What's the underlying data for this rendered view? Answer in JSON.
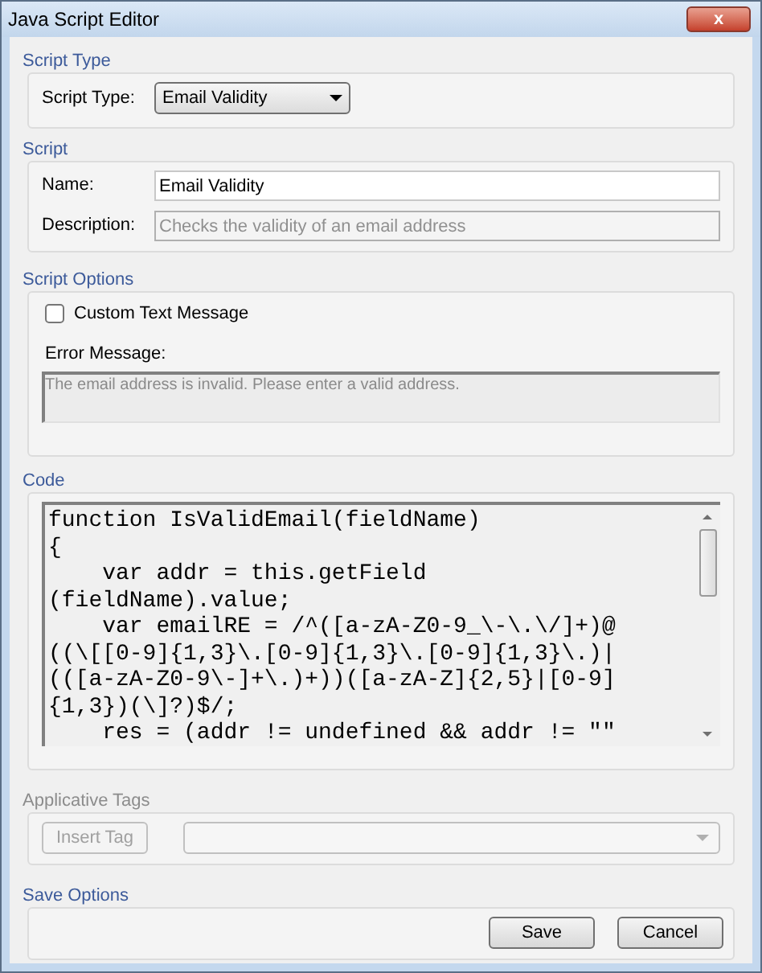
{
  "window": {
    "title": "Java Script Editor",
    "close_label": "x"
  },
  "script_type": {
    "legend": "Script Type",
    "label": "Script Type:",
    "value": "Email Validity"
  },
  "script": {
    "legend": "Script",
    "name_label": "Name:",
    "name_value": "Email Validity",
    "description_label": "Description:",
    "description_placeholder": "Checks the validity of an email address"
  },
  "script_options": {
    "legend": "Script Options",
    "custom_text": {
      "label": "Custom Text Message",
      "checked": false
    },
    "error_label": "Error Message:",
    "error_value": "The email address is invalid. Please enter a valid address.",
    "error_disabled": true
  },
  "code": {
    "legend": "Code",
    "lines": [
      "function IsValidEmail(fieldName)",
      "{",
      "    var addr = this.getField",
      "(fieldName).value;",
      "    var emailRE = /^([a-zA-Z0-9_\\-\\.\\/]+)@",
      "((\\[[0-9]{1,3}\\.[0-9]{1,3}\\.[0-9]{1,3}\\.)|",
      "(([a-zA-Z0-9\\-]+\\.)+))([a-zA-Z]{2,5}|[0-9]",
      "{1,3})(\\]?)$/;",
      "    res = (addr != undefined && addr != \"\""
    ]
  },
  "applicative_tags": {
    "legend": "Applicative Tags",
    "disabled": true,
    "insert_button": "Insert Tag"
  },
  "save_options": {
    "legend": "Save Options",
    "buttons": [
      "Save",
      "Cancel"
    ]
  }
}
